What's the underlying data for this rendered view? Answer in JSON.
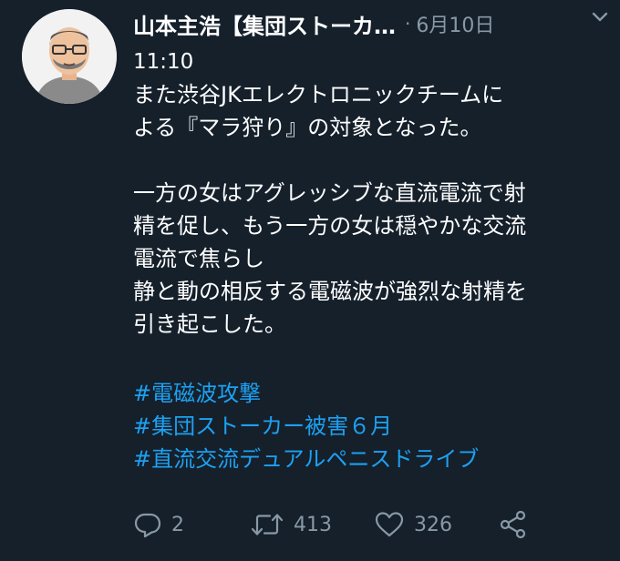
{
  "tweet": {
    "display_name": "山本主浩【集団ストーカ…",
    "separator": "·",
    "date": "6月10日",
    "time": "11:10",
    "body_lines": [
      "また渋谷JKエレクトロニックチームに",
      "よる『マラ狩り』の対象となった。",
      "",
      "一方の女はアグレッシブな直流電流で射",
      "精を促し、もう一方の女は穏やかな交流",
      "電流で焦らし",
      "静と動の相反する電磁波が強烈な射精を",
      "引き起こした。"
    ],
    "hashtags": [
      "#電磁波攻撃",
      "#集団ストーカー被害６月",
      "#直流交流デュアルペニスドライブ"
    ]
  },
  "actions": {
    "reply_count": "2",
    "retweet_count": "413",
    "like_count": "326"
  },
  "icons": {
    "menu": "chevron-down-icon",
    "reply": "reply-icon",
    "retweet": "retweet-icon",
    "like": "heart-icon",
    "share": "share-icon"
  },
  "colors": {
    "background": "#15202b",
    "text": "#ffffff",
    "secondary": "#8899a6",
    "link": "#1da1f2"
  }
}
